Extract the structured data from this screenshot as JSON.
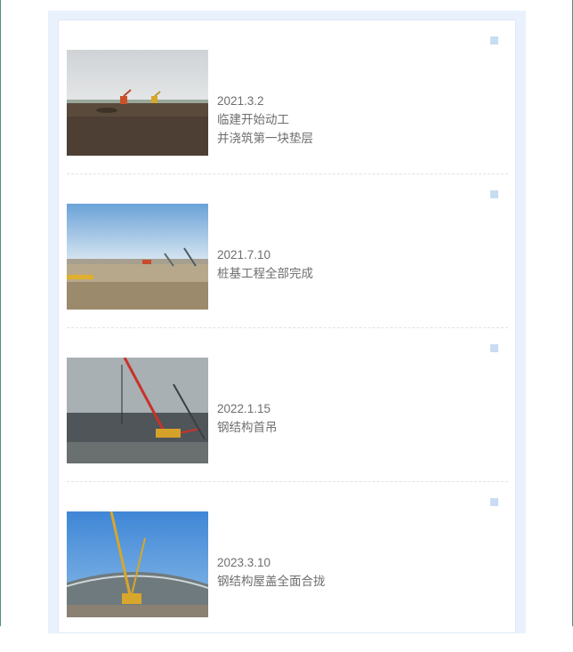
{
  "timeline": {
    "items": [
      {
        "date": "2021.3.2",
        "lines": [
          "临建开始动工",
          "并浇筑第一块垫层"
        ],
        "photo": "excavators-on-muddy-field"
      },
      {
        "date": "2021.7.10",
        "lines": [
          "桩基工程全部完成"
        ],
        "photo": "piling-site-under-blue-sky"
      },
      {
        "date": "2022.1.15",
        "lines": [
          "钢结构首吊"
        ],
        "photo": "red-crawler-crane-overcast"
      },
      {
        "date": "2023.3.10",
        "lines": [
          "钢结构屋盖全面合拢"
        ],
        "photo": "yellow-crane-steel-roof"
      }
    ]
  },
  "colors": {
    "page_bg": "#e8f1fc",
    "marker": "#c8ddf3",
    "text": "#6e6e6e",
    "frame": "#4f8f8a"
  }
}
